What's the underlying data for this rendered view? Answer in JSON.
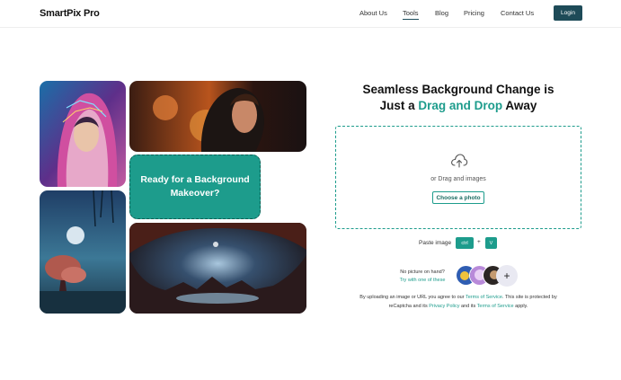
{
  "header": {
    "logo": "SmartPix Pro",
    "nav": [
      "About Us",
      "Tools",
      "Blog",
      "Pricing",
      "Contact Us"
    ],
    "active_nav": "Tools",
    "login_label": "Login"
  },
  "gallery": {
    "tiles": [
      "hooded-woman-neon-portrait",
      "woman-profile-autumn-double-exposure",
      "misty-tree-under-moon",
      "cosmic-cave-landscape"
    ],
    "promo_text": "Ready for a Background Makeover?"
  },
  "hero": {
    "headline_part1": "Seamless Background Change is",
    "headline_part2": "Just a ",
    "headline_accent": "Drag and Drop",
    "headline_part3": " Away"
  },
  "upload": {
    "icon": "cloud-upload-icon",
    "drag_text": "or Drag and images",
    "choose_label": "Choose a photo"
  },
  "paste": {
    "label": "Paste image",
    "key1": "ctrl",
    "plus": "+",
    "key2": "V"
  },
  "samples": {
    "no_picture": "No picture on hand?",
    "try_text": "Try with one of these",
    "add_icon": "+"
  },
  "terms": {
    "t1": "By uploading an image or URL you agree to our ",
    "tos1": "Terms of Service",
    "t2": ". This site is protected by reCaptcha and its ",
    "privacy": "Privacy Policy",
    "t3": " and its ",
    "tos2": "Terms of Service",
    "t4": " apply."
  },
  "colors": {
    "accent": "#1d9c8c",
    "login_bg": "#1e4b58"
  }
}
